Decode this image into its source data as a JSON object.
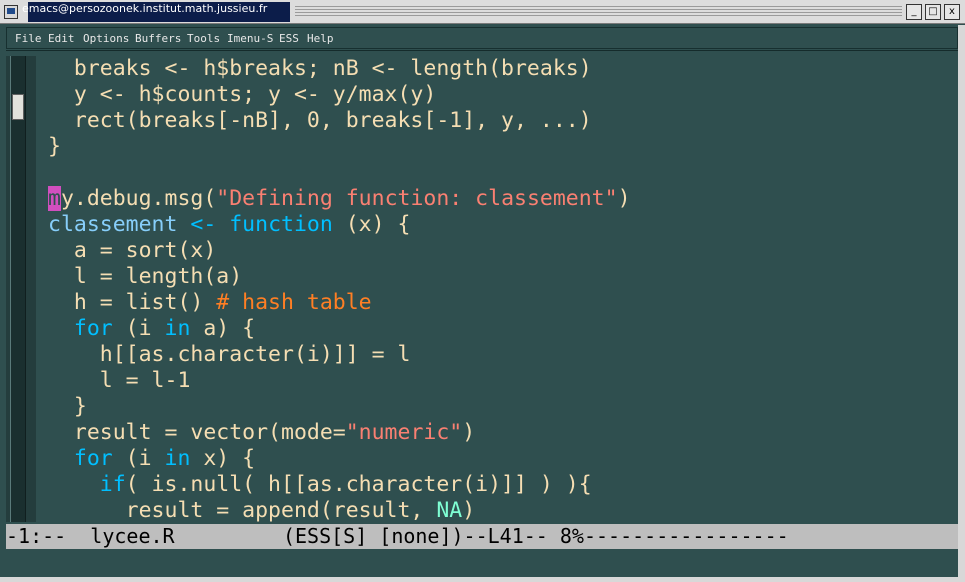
{
  "window": {
    "title": "emacs@persozoonek.institut.math.jussieu.fr",
    "buttons": {
      "minimize": "_",
      "maximize": "□",
      "close": "x"
    }
  },
  "menu": [
    "File",
    "Edit",
    "Options",
    "Buffers",
    "Tools",
    "Imenu-S",
    "ESS",
    "Help"
  ],
  "editor": {
    "lines": [
      "  breaks <- h$breaks; nB <- length(breaks)",
      "  y <- h$counts; y <- y/max(y)",
      "  rect(breaks[-nB], 0, breaks[-1], y, ...)",
      "}",
      "",
      "my.debug.msg(\"Defining function: classement\")",
      "classement <- function (x) {",
      "  a = sort(x)",
      "  l = length(a)",
      "  h = list() # hash table",
      "  for (i in a) {",
      "    h[[as.character(i)]] = l",
      "    l = l-1",
      "  }",
      "  result = vector(mode=\"numeric\")",
      "  for (i in x) {",
      "    if( is.null( h[[as.character(i)]] ) ){",
      "      result = append(result, NA)"
    ],
    "cursor": {
      "line": 6,
      "column": 1
    }
  },
  "modeline": {
    "text": "-1:--  lycee.R         (ESS[S] [none])--L41-- 8%-----------------"
  },
  "colors": {
    "background": "#2f4f4f",
    "foreground": "#f5deb3",
    "keyword": "#00bfff",
    "function_name": "#87cefa",
    "string": "#fa8072",
    "comment": "#ff7f24",
    "constant": "#7fffd4",
    "cursor": "#d14fbf",
    "modeline_bg": "#bebebe"
  }
}
